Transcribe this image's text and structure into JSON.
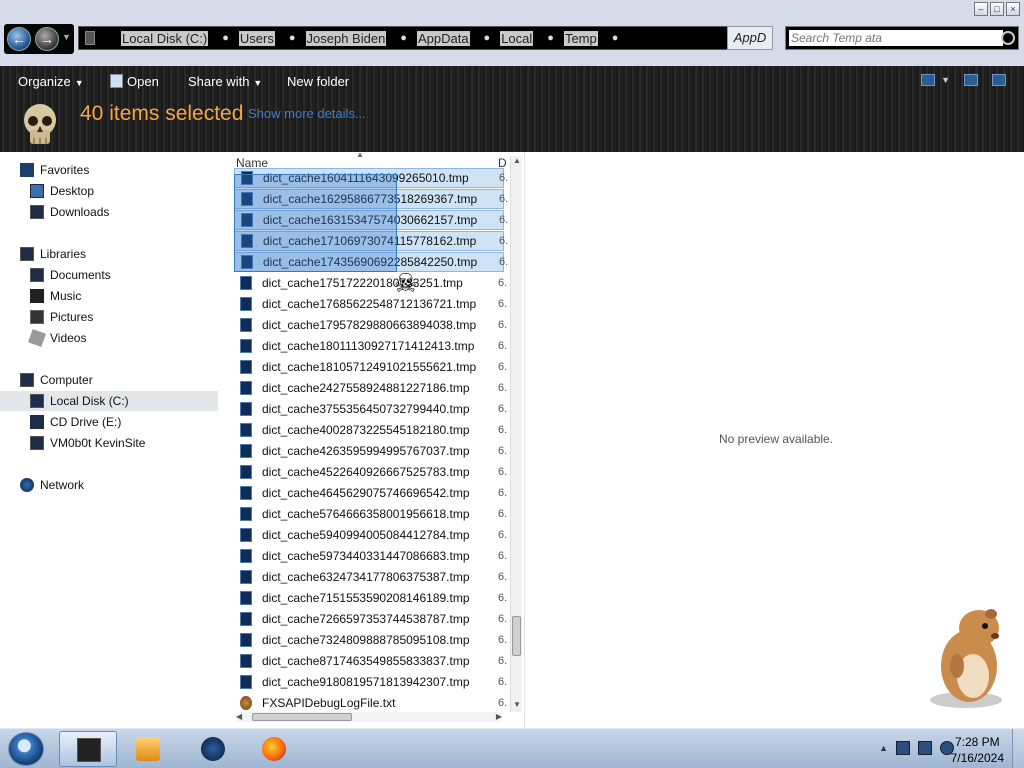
{
  "window": {
    "breadcrumbs": [
      "Local Disk (C:)",
      "Users",
      "Joseph Biden",
      "AppData",
      "Local",
      "Temp"
    ],
    "address_overlay": "AppD",
    "search_placeholder": "Search Temp ata"
  },
  "toolbar": {
    "organize": "Organize",
    "open": "Open",
    "share_with": "Share with",
    "new_folder": "New folder"
  },
  "details": {
    "selection_count": "40 items selected",
    "show_more": "Show more details..."
  },
  "sidebar": {
    "favorites": "Favorites",
    "desktop": "Desktop",
    "downloads": "Downloads",
    "libraries": "Libraries",
    "documents": "Documents",
    "music": "Music",
    "pictures": "Pictures",
    "videos": "Videos",
    "computer": "Computer",
    "local_disk": "Local Disk (C:)",
    "cd_drive": "CD Drive (E:)",
    "vm_site": "VM0b0t KevinSite",
    "network": "Network"
  },
  "filelist": {
    "column_name": "Name",
    "column_d": "D",
    "files": [
      {
        "name": "dict_cache1604111643099265010.tmp",
        "d": "6.",
        "selected": true
      },
      {
        "name": "dict_cache1629586677351826936​7.tmp",
        "d": "6.",
        "selected": true
      },
      {
        "name": "dict_cache1631534757403066215​7.tmp",
        "d": "6.",
        "selected": true
      },
      {
        "name": "dict_cache1710697307411577816​2.tmp",
        "d": "6.",
        "selected": true
      },
      {
        "name": "dict_cache1743569069228584225​0.tmp",
        "d": "6.",
        "selected": true
      },
      {
        "name": "dict_cache1751722201807332​51.tmp",
        "d": "6.",
        "selected": false
      },
      {
        "name": "dict_cache1768562254871213672​1.tmp",
        "d": "6.",
        "selected": false
      },
      {
        "name": "dict_cache1795782988066389403​8.tmp",
        "d": "6.",
        "selected": false
      },
      {
        "name": "dict_cache1801113092717141241​3.tmp",
        "d": "6.",
        "selected": false
      },
      {
        "name": "dict_cache1810571249102155562​1.tmp",
        "d": "6.",
        "selected": false
      },
      {
        "name": "dict_cache2427558924881227186.tmp",
        "d": "6.",
        "selected": false
      },
      {
        "name": "dict_cache3755356450732799440.tmp",
        "d": "6.",
        "selected": false
      },
      {
        "name": "dict_cache4002873225545182180.tmp",
        "d": "6.",
        "selected": false
      },
      {
        "name": "dict_cache4263595994995767037.tmp",
        "d": "6.",
        "selected": false
      },
      {
        "name": "dict_cache4522640926667525783.tmp",
        "d": "6.",
        "selected": false
      },
      {
        "name": "dict_cache4645629075746696542.tmp",
        "d": "6.",
        "selected": false
      },
      {
        "name": "dict_cache5764666358001956618.tmp",
        "d": "6.",
        "selected": false
      },
      {
        "name": "dict_cache5940994005084412784.tmp",
        "d": "6.",
        "selected": false
      },
      {
        "name": "dict_cache5973440331447086683.tmp",
        "d": "6.",
        "selected": false
      },
      {
        "name": "dict_cache6324734177806375387.tmp",
        "d": "6.",
        "selected": false
      },
      {
        "name": "dict_cache7151553590208146189.tmp",
        "d": "6.",
        "selected": false
      },
      {
        "name": "dict_cache7266597353744538787.tmp",
        "d": "6.",
        "selected": false
      },
      {
        "name": "dict_cache7324809888785095108.tmp",
        "d": "6.",
        "selected": false
      },
      {
        "name": "dict_cache8717463549855833837.tmp",
        "d": "6.",
        "selected": false
      },
      {
        "name": "dict_cache9180819571813942307.tmp",
        "d": "6.",
        "selected": false
      },
      {
        "name": "FXSAPIDebugLogFile.txt",
        "d": "6.",
        "selected": false
      }
    ]
  },
  "preview": {
    "message": "No preview available."
  },
  "taskbar": {
    "time": "7:28 PM",
    "date": "7/16/2024"
  }
}
